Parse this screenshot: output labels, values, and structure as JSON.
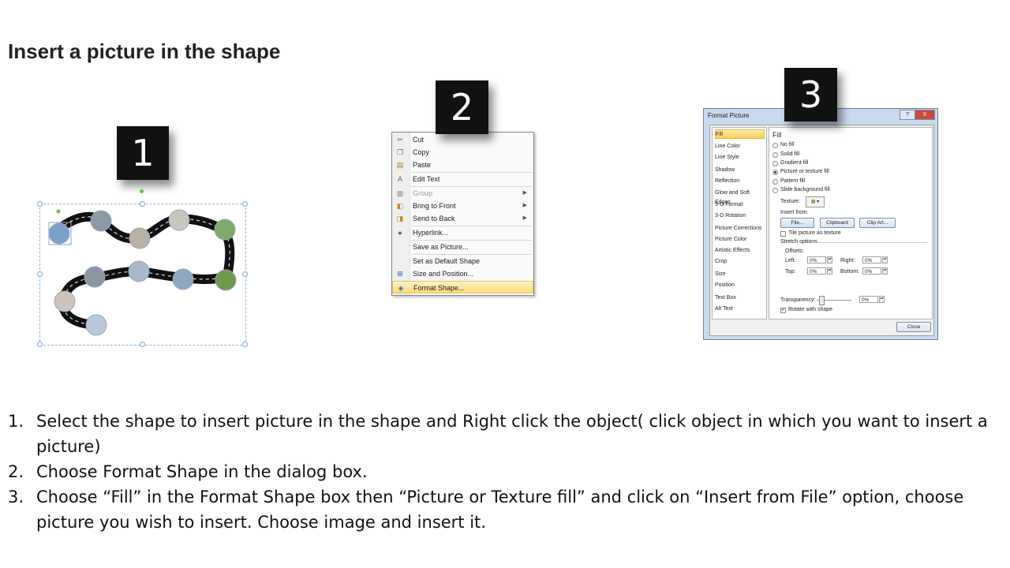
{
  "title": "Insert a picture in the shape",
  "steps": {
    "badges": [
      "1",
      "2",
      "3"
    ]
  },
  "context_menu": {
    "items": [
      {
        "label": "Cut",
        "icon": "scissors-icon",
        "disabled": false,
        "submenu": false
      },
      {
        "label": "Copy",
        "icon": "copy-icon",
        "disabled": false,
        "submenu": false
      },
      {
        "label": "Paste",
        "icon": "paste-icon",
        "disabled": false,
        "submenu": false
      },
      {
        "label": "Edit Text",
        "icon": "edit-text-icon",
        "disabled": false,
        "submenu": false
      },
      {
        "label": "Group",
        "icon": "group-icon",
        "disabled": true,
        "submenu": true
      },
      {
        "label": "Bring to Front",
        "icon": "bring-front-icon",
        "disabled": false,
        "submenu": true
      },
      {
        "label": "Send to Back",
        "icon": "send-back-icon",
        "disabled": false,
        "submenu": true
      },
      {
        "label": "Hyperlink...",
        "icon": "globe-link-icon",
        "disabled": false,
        "submenu": false
      },
      {
        "label": "Save as Picture...",
        "icon": "",
        "disabled": false,
        "submenu": false
      },
      {
        "label": "Set as Default Shape",
        "icon": "",
        "disabled": false,
        "submenu": false
      },
      {
        "label": "Size and Position...",
        "icon": "size-position-icon",
        "disabled": false,
        "submenu": false
      },
      {
        "label": "Format Shape...",
        "icon": "format-shape-icon",
        "disabled": false,
        "submenu": false,
        "highlighted": true
      }
    ]
  },
  "format_dialog": {
    "title": "Format Picture",
    "help_button": "?",
    "close_x": "X",
    "categories": [
      "Fill",
      "Line Color",
      "Line Style",
      "Shadow",
      "Reflection",
      "Glow and Soft Edges",
      "3-D Format",
      "3-D Rotation",
      "Picture Corrections",
      "Picture Color",
      "Artistic Effects",
      "Crop",
      "Size",
      "Position",
      "Text Box",
      "Alt Text"
    ],
    "pane_title": "Fill",
    "fill_options": [
      "No fill",
      "Solid fill",
      "Gradient fill",
      "Picture or texture fill",
      "Pattern fill",
      "Slide background fill"
    ],
    "selected_fill": "Picture or texture fill",
    "texture_label": "Texture:",
    "insert_from_label": "Insert from:",
    "file_button": "File...",
    "clipboard_button": "Clipboard",
    "clipart_button": "Clip Art...",
    "tile_label": "Tile picture as texture",
    "stretch_label": "Stretch options",
    "offsets_label": "Offsets:",
    "left_label": "Left:",
    "left_value": "0%",
    "right_label": "Right:",
    "right_value": "0%",
    "top_label": "Top:",
    "top_value": "0%",
    "bottom_label": "Bottom:",
    "bottom_value": "0%",
    "transparency_label": "Transparency:",
    "transparency_value": "0%",
    "rotate_label": "Rotate with shape",
    "close_button": "Close"
  },
  "instructions": [
    {
      "num": "1.",
      "text": "Select the shape to insert picture in the shape and Right click the object( click object in which you want to insert a picture)"
    },
    {
      "num": "2.",
      "text": "Choose Format Shape in the dialog box."
    },
    {
      "num": "3.",
      "text": "Choose “Fill” in the Format Shape box then “Picture or Texture fill”  and click on “Insert from File” option, choose picture you wish to insert. Choose image and insert it."
    }
  ]
}
